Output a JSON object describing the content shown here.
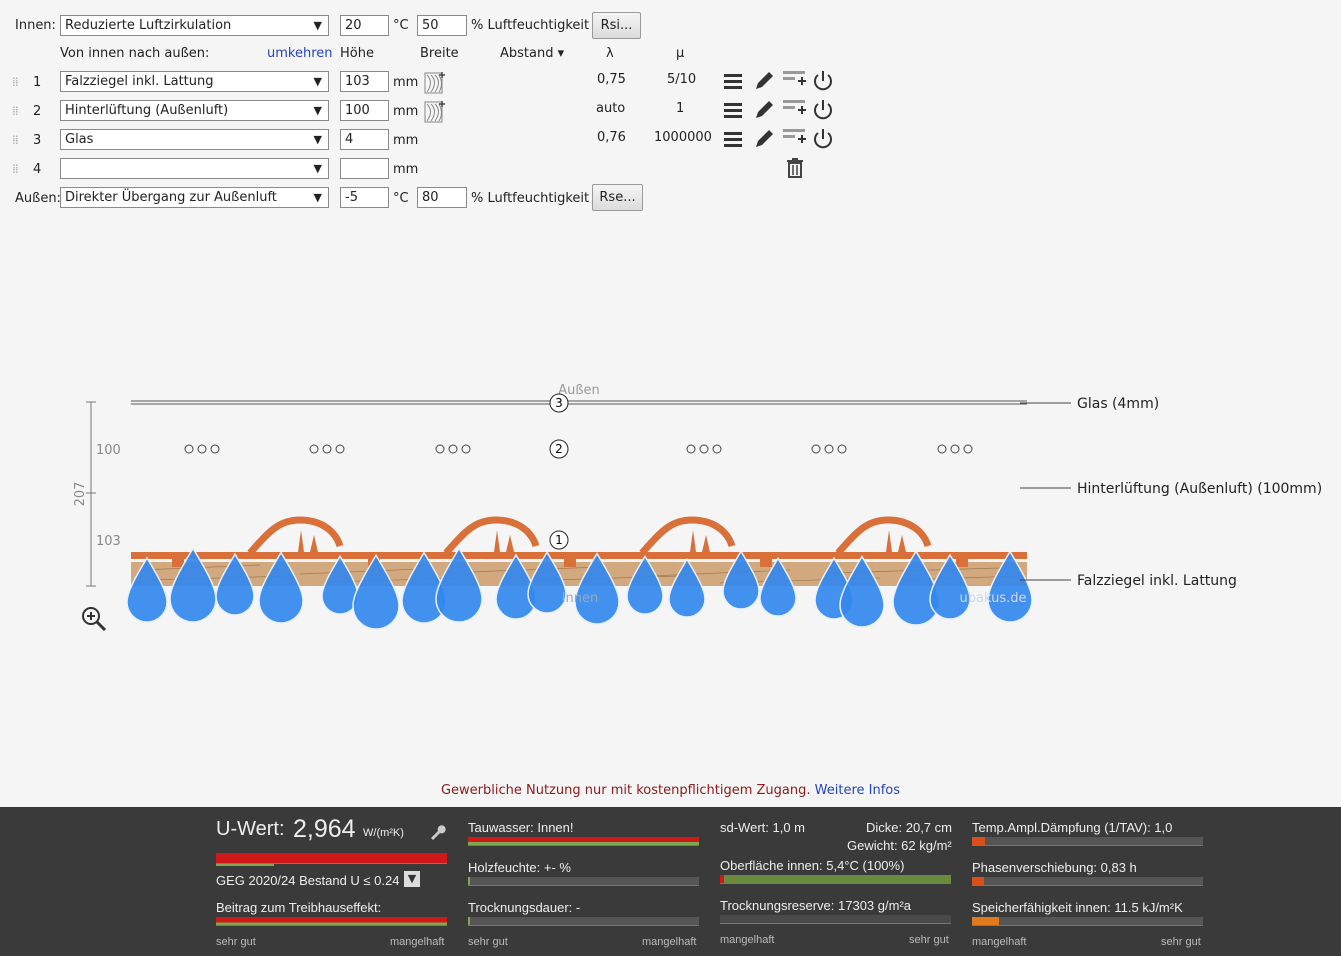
{
  "indoor": {
    "label": "Innen:",
    "select": "Reduzierte Luftzirkulation",
    "temp": "20",
    "temp_unit": "°C",
    "humidity": "50",
    "humidity_label": "% Luftfeuchtigkeit",
    "button": "Rsi..."
  },
  "header": {
    "direction": "Von innen nach außen:",
    "reverse": "umkehren",
    "height": "Höhe",
    "width": "Breite",
    "spacing": "Abstand ▾",
    "lambda": "λ",
    "mu": "μ"
  },
  "layers": [
    {
      "num": "1",
      "material": "Falzziegel inkl. Lattung",
      "thickness": "103",
      "unit": "mm",
      "lambda": "0,75",
      "mu": "5/10"
    },
    {
      "num": "2",
      "material": "Hinterlüftung (Außenluft)",
      "thickness": "100",
      "unit": "mm",
      "lambda": "auto",
      "mu": "1"
    },
    {
      "num": "3",
      "material": "Glas",
      "thickness": "4",
      "unit": "mm",
      "lambda": "0,76",
      "mu": "1000000"
    },
    {
      "num": "4",
      "material": "",
      "thickness": "",
      "unit": "mm",
      "lambda": "",
      "mu": ""
    }
  ],
  "outdoor": {
    "label": "Außen:",
    "select": "Direkter Übergang zur Außenluft",
    "temp": "-5",
    "temp_unit": "°C",
    "humidity": "80",
    "humidity_label": "% Luftfeuchtigkeit",
    "button": "Rse..."
  },
  "diagram": {
    "outside": "Außen",
    "inside": "Innen",
    "watermark": "ubakus.de",
    "dim_total": "207",
    "dim_upper": "100",
    "dim_lower": "103",
    "callouts": [
      "Glas (4mm)",
      "Hinterlüftung (Außenluft) (100mm)",
      "Falzziegel inkl. Lattung"
    ],
    "markers": [
      "3",
      "2",
      "1"
    ]
  },
  "notice": {
    "text": "Gewerbliche Nutzung nur mit kostenpflichtigem Zugang.",
    "link": "Weitere Infos"
  },
  "footer": {
    "uwert_label": "U-Wert:",
    "uwert_value": "2,964",
    "uwert_unit": "W/(m²K)",
    "geg": "GEG 2020/24 Bestand U ≤ 0.24",
    "greenhouse": "Beitrag zum Treibhauseffekt:",
    "tauwasser": "Tauwasser: Innen!",
    "holzfeuchte": "Holzfeuchte: +- %",
    "trocknungsdauer": "Trocknungsdauer: -",
    "sd": "sd-Wert: 1,0 m",
    "dicke": "Dicke: 20,7 cm",
    "gewicht": "Gewicht: 62 kg/m²",
    "oberflaeche": "Oberfläche innen: 5,4°C (100%)",
    "trocknungsreserve": "Trocknungsreserve: 17303 g/m²a",
    "tav": "Temp.Ampl.Dämpfung (1/TAV): 1,0",
    "phase": "Phasenverschiebung: 0,83 h",
    "speicher": "Speicherfähigkeit innen: 11.5 kJ/m²K",
    "scale_good": "sehr gut",
    "scale_bad": "mangelhaft"
  }
}
